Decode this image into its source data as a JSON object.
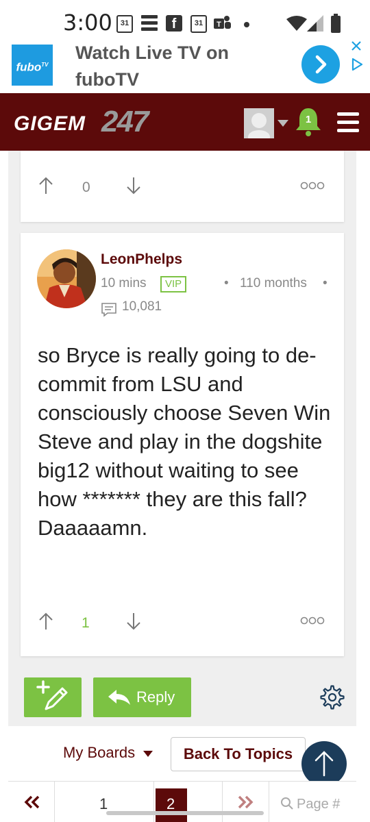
{
  "status_bar": {
    "time": "3:00",
    "calendar_day_1": "31",
    "calendar_day_2": "31",
    "icons": [
      "calendar-icon",
      "e-icon",
      "facebook-icon",
      "calendar-icon",
      "teams-icon",
      "dot-icon",
      "wifi-icon",
      "signal-icon",
      "battery-icon"
    ]
  },
  "ad": {
    "logo_text": "fubo",
    "logo_superscript": "TV",
    "headline": "Watch Live TV on fuboTV",
    "accent_color": "#1da1e2"
  },
  "header": {
    "logo_text": "GIGEM",
    "logo_number": "247",
    "notification_count": "1",
    "brand_color": "#5c0a0a"
  },
  "top_post": {
    "vote_count": "0"
  },
  "post": {
    "username": "LeonPhelps",
    "time_ago": "10 mins",
    "badge": "VIP",
    "membership": "110 months",
    "post_count": "10,081",
    "body": "so Bryce is really going to de-commit from LSU and consciously choose Seven Win Steve and play in the dogshite big12 without waiting to see how ******* they are this fall? Daaaaamn.",
    "vote_count": "1"
  },
  "actions": {
    "reply_label": "Reply",
    "accent_color": "#7cc243"
  },
  "footer": {
    "my_boards_label": "My Boards",
    "back_to_topics_label": "Back To Topics",
    "pages": [
      "1",
      "2"
    ],
    "current_page": "2",
    "page_input_placeholder": "Page #"
  }
}
